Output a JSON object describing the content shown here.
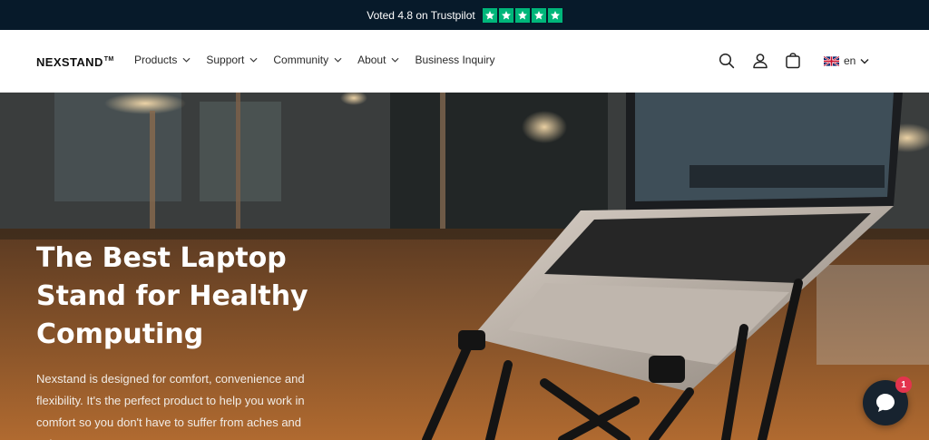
{
  "announcement": {
    "text": "Voted 4.8 on Trustpilot",
    "rating_stars": 5,
    "star_color": "#00b67a"
  },
  "header": {
    "logo": "NEXSTAND",
    "logo_mark": "TM",
    "nav": [
      {
        "label": "Products",
        "has_dropdown": true
      },
      {
        "label": "Support",
        "has_dropdown": true
      },
      {
        "label": "Community",
        "has_dropdown": true
      },
      {
        "label": "About",
        "has_dropdown": true
      },
      {
        "label": "Business Inquiry",
        "has_dropdown": false
      }
    ],
    "icons": [
      "search-icon",
      "account-icon",
      "cart-icon"
    ],
    "language": "en",
    "language_flag": "uk-flag-icon"
  },
  "hero": {
    "title": "The Best Laptop Stand for Healthy Computing",
    "description": "Nexstand is designed for comfort, convenience and flexibility. It's the perfect product to help you work in comfort so you don't have to suffer from aches and pains."
  },
  "chat": {
    "badge_count": "1",
    "icon": "chat-icon"
  },
  "colors": {
    "announcement_bg": "#071a2a",
    "chat_bg": "#17232f",
    "badge_bg": "#e3344d"
  }
}
